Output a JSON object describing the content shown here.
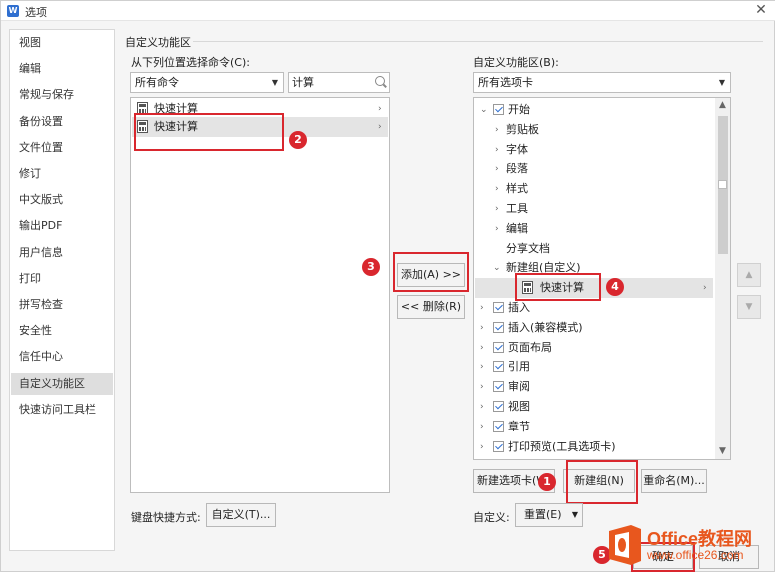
{
  "window": {
    "title": "选项",
    "app_icon": "W"
  },
  "sidebar": {
    "items": [
      "视图",
      "编辑",
      "常规与保存",
      "备份设置",
      "文件位置",
      "修订",
      "中文版式",
      "输出PDF",
      "用户信息",
      "打印",
      "拼写检查",
      "安全性",
      "信任中心",
      "自定义功能区",
      "快速访问工具栏"
    ],
    "selected": 13
  },
  "section": {
    "title": "自定义功能区"
  },
  "left": {
    "label": "从下列位置选择命令(C):",
    "dropdown": "所有命令",
    "search_value": "计算",
    "items": [
      "快速计算",
      "快速计算"
    ]
  },
  "right": {
    "label": "自定义功能区(B):",
    "dropdown": "所有选项卡",
    "tree": {
      "start": "开始",
      "start_children": [
        "剪贴板",
        "字体",
        "段落",
        "样式",
        "工具",
        "编辑"
      ],
      "share": "分享文档",
      "new_group": "新建组(自定义)",
      "new_group_item": "快速计算",
      "tabs": [
        "插入",
        "插入(兼容模式)",
        "页面布局",
        "引用",
        "审阅",
        "视图",
        "章节",
        "打印预览(工具选项卡)"
      ]
    }
  },
  "buttons": {
    "add": "添加(A) >>",
    "remove": "<< 删除(R)",
    "new_tab": "新建选项卡(W)",
    "new_group": "新建组(N)",
    "rename": "重命名(M)...",
    "keyboard_label": "键盘快捷方式:",
    "customize": "自定义(T)...",
    "custom_label": "自定义:",
    "reset": "重置(E)",
    "ok": "确定",
    "cancel": "取消"
  },
  "badges": [
    "1",
    "2",
    "3",
    "4",
    "5"
  ],
  "watermark": {
    "brand": "Office教程网",
    "url": "www.office26.com"
  },
  "colors": {
    "annotation_red": "#d9272e",
    "selected_bg": "#dedede",
    "brand_orange": "#e8571e"
  }
}
